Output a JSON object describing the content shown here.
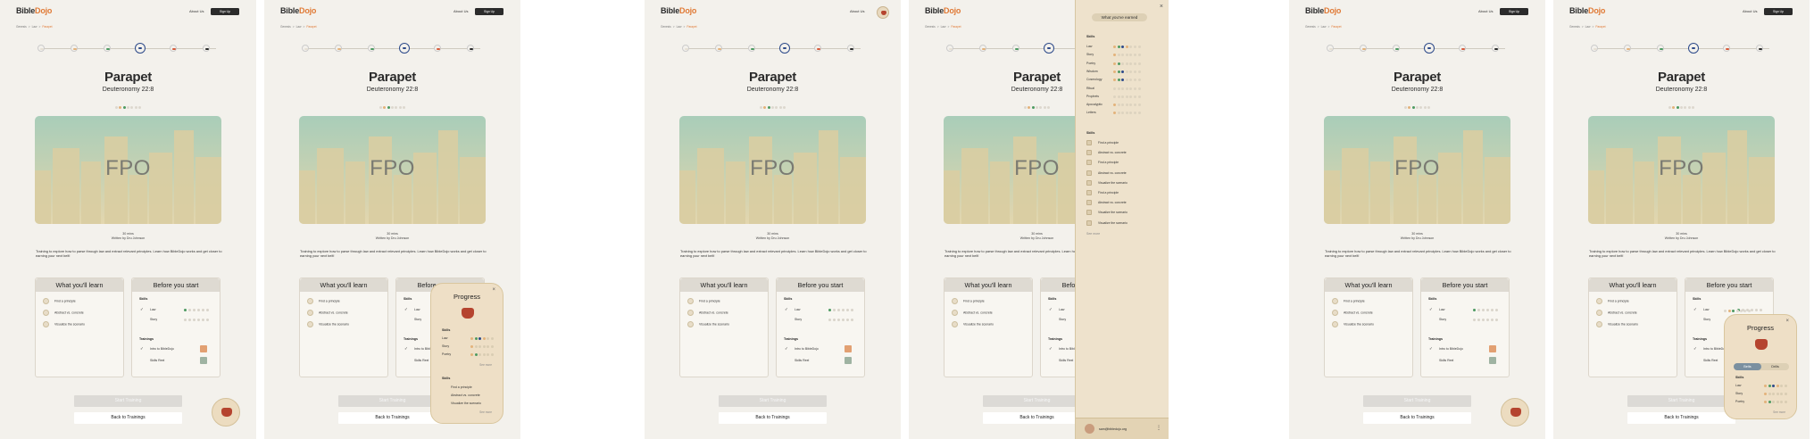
{
  "brand": {
    "bible": "Bible",
    "dojo": "Dojo"
  },
  "nav": {
    "about": "About Us",
    "signup": "Sign Up"
  },
  "breadcrumb": {
    "home": "Genesis",
    "sep": ">",
    "section": "Law",
    "current": "Parapet"
  },
  "lesson": {
    "title": "Parapet",
    "reference": "Deuteronomy 22:8",
    "hero_placeholder": "FPO",
    "duration": "30 mins",
    "author": "Written by Dru Johnson",
    "description": "Training to explore how to parse through law and extract relevant principles. Learn how BibleDojo works and get closer to earning your next belt!"
  },
  "learn": {
    "header": "What you'll learn",
    "items": [
      "Find a principle",
      "Abstract vs. concrete",
      "Visualize the scenario"
    ]
  },
  "before": {
    "header": "Before you start",
    "skills_label": "Skills",
    "skills": [
      "Law",
      "Story"
    ],
    "trainings_label": "Trainings",
    "trainings": [
      "Intro to BibleDojo",
      "Skills Reel"
    ]
  },
  "buttons": {
    "start": "Start Training",
    "back": "Back to Trainings"
  },
  "belts": {
    "colors": [
      "#e6e0d4",
      "#e3b27a",
      "#4d9a61",
      "#2d4a8a",
      "#d65b3b",
      "#2b2b2b"
    ]
  },
  "progress_popup": {
    "title": "Progress",
    "close": "×",
    "skills_label": "Skills",
    "skills": [
      "Law",
      "Story",
      "Poetry"
    ],
    "see_more": "See more",
    "trainings_label": "Skills",
    "trainings": [
      "Find a principle",
      "Abstract vs. concrete",
      "Visualize the scenario"
    ],
    "see_more2": "See more"
  },
  "drawer": {
    "title": "What you've earned",
    "close": "×",
    "skills_label": "Skills",
    "skills": [
      "Law",
      "Story",
      "Poetry",
      "Wisdom",
      "Cosmology",
      "Ritual",
      "Prophets",
      "Apocalyptic",
      "Letters"
    ],
    "trainings_label": "Skills",
    "trainings": [
      "Find a principle",
      "Abstract vs. concrete",
      "Find a principle",
      "Abstract vs. concrete",
      "Visualize the scenario",
      "Find a principle",
      "Abstract vs. concrete",
      "Visualize the scenario",
      "Visualize the scenario"
    ],
    "see_more": "See more",
    "email": "sam@bibledojo.org",
    "menu": "⋮"
  },
  "progress_popup2": {
    "title": "Progress",
    "close": "×",
    "tabs": [
      "Belts",
      "Drills"
    ],
    "skills_label": "Skills",
    "skills": [
      "Law",
      "Story",
      "Poetry"
    ],
    "see_more": "See more"
  }
}
